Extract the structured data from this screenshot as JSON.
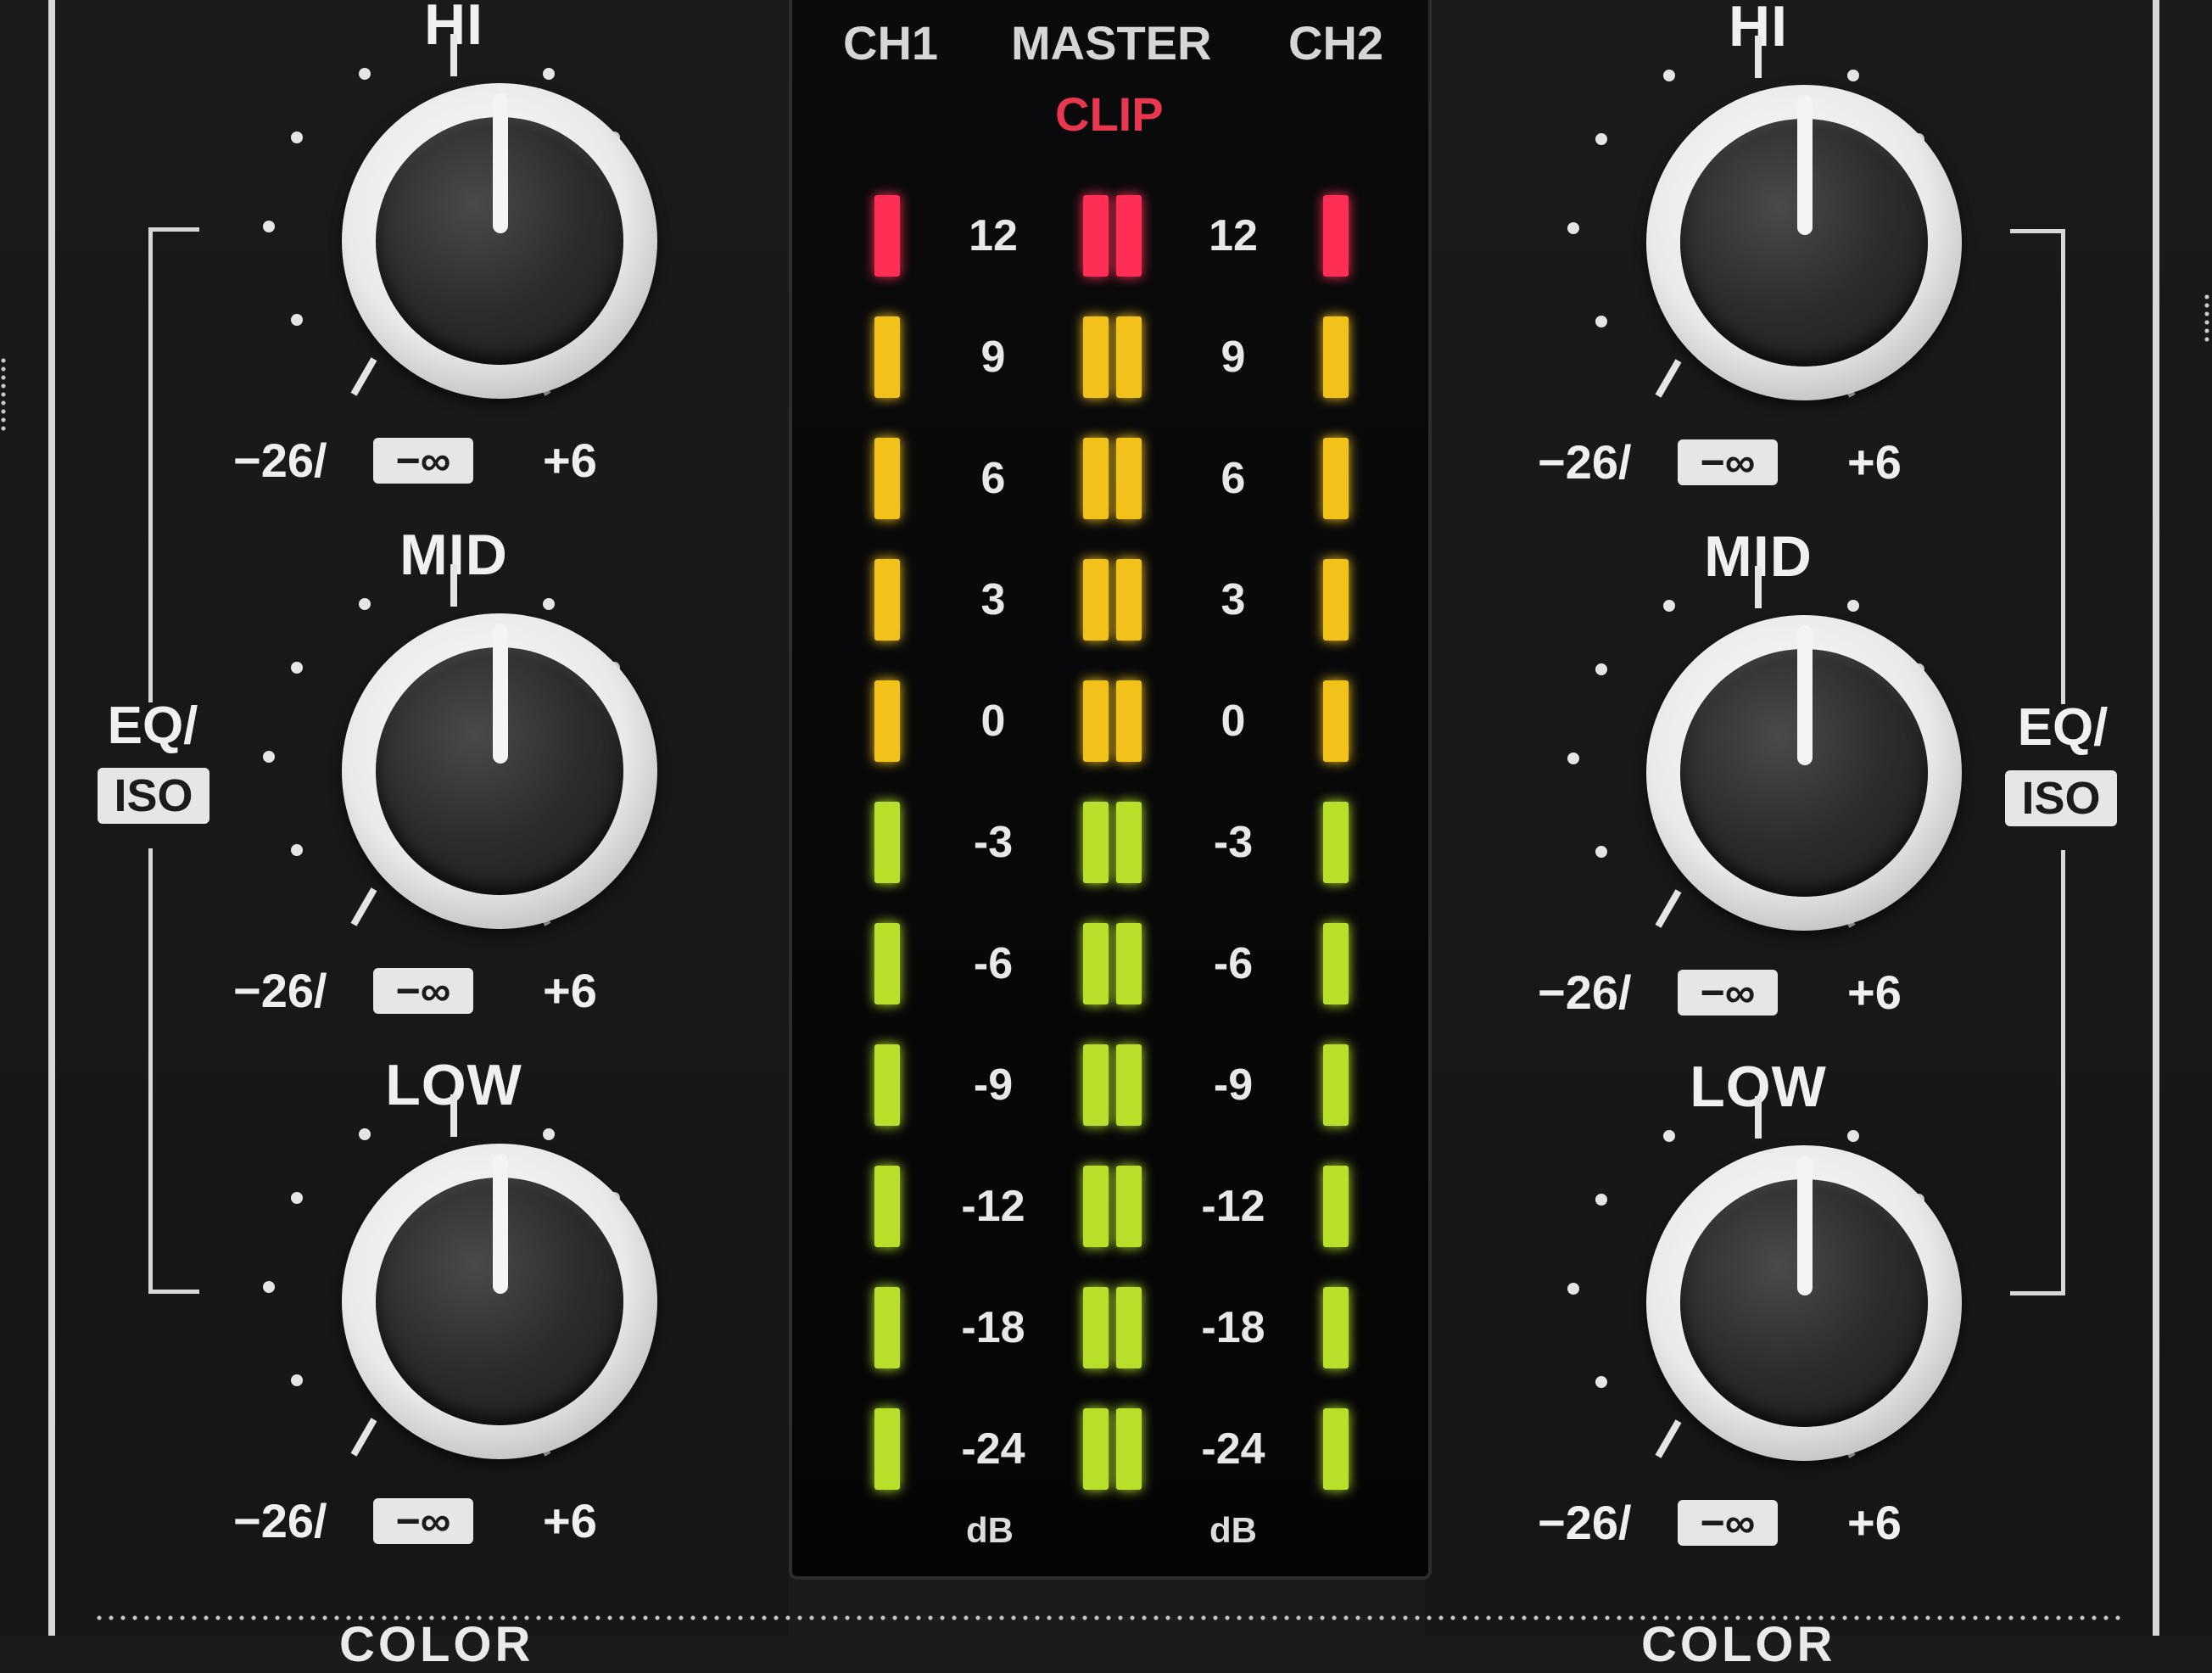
{
  "meter": {
    "ch1_label": "CH1",
    "master_label": "MASTER",
    "ch2_label": "CH2",
    "clip_label": "CLIP",
    "scale": [
      "12",
      "9",
      "6",
      "3",
      "0",
      "-3",
      "-6",
      "-9",
      "-12",
      "-18",
      "-24"
    ],
    "unit": "dB",
    "colors": {
      "clip": "#ff2e55",
      "yellow": "#f2c21a",
      "green": "#b8e02a"
    }
  },
  "left_strip": {
    "knobs": [
      {
        "title": "HI",
        "min": "−26/",
        "inf": "−∞",
        "max": "+6"
      },
      {
        "title": "MID",
        "min": "−26/",
        "inf": "−∞",
        "max": "+6"
      },
      {
        "title": "LOW",
        "min": "−26/",
        "inf": "−∞",
        "max": "+6"
      }
    ],
    "eq_label": "EQ/",
    "iso_label": "ISO",
    "color_label": "COLOR"
  },
  "right_strip": {
    "knobs": [
      {
        "title": "HI",
        "min": "−26/",
        "inf": "−∞",
        "max": "+6"
      },
      {
        "title": "MID",
        "min": "−26/",
        "inf": "−∞",
        "max": "+6"
      },
      {
        "title": "LOW",
        "min": "−26/",
        "inf": "−∞",
        "max": "+6"
      }
    ],
    "eq_label": "EQ/",
    "iso_label": "ISO",
    "color_label": "COLOR"
  }
}
